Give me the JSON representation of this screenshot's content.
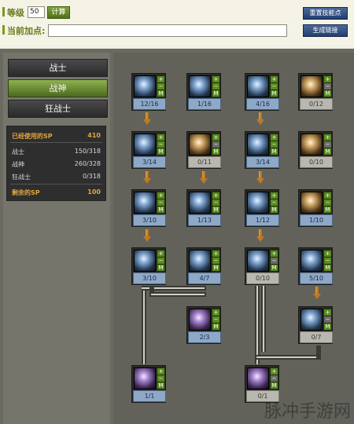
{
  "top": {
    "level_label": "等级",
    "level_value": "50",
    "calc_button": "计算",
    "points_label": "当前加点:",
    "points_value": "",
    "reset_button": "重置技能点",
    "link_button": "生成链接"
  },
  "jobs": [
    {
      "label": "战士",
      "active": false
    },
    {
      "label": "战神",
      "active": true
    },
    {
      "label": "狂战士",
      "active": false
    }
  ],
  "sp": {
    "used_label": "已经使用的SP",
    "used_value": "410",
    "rows": [
      {
        "label": "战士",
        "value": "150/318"
      },
      {
        "label": "战神",
        "value": "260/328"
      },
      {
        "label": "狂战士",
        "value": "0/318"
      }
    ],
    "remaining_label": "剩余的SP",
    "remaining_value": "100"
  },
  "skills": [
    {
      "count": "12/16",
      "icon": "skill-icon-1",
      "tone": "cool"
    },
    {
      "count": "1/16",
      "icon": "skill-icon-2",
      "tone": "cool"
    },
    {
      "count": "4/16",
      "icon": "skill-icon-3",
      "tone": "cool"
    },
    {
      "count": "0/12",
      "icon": "skill-icon-4",
      "tone": "warm"
    },
    {
      "count": "3/14",
      "icon": "skill-icon-5",
      "tone": "cool"
    },
    {
      "count": "0/11",
      "icon": "skill-icon-6",
      "tone": "warm"
    },
    {
      "count": "3/14",
      "icon": "skill-icon-7",
      "tone": "cool"
    },
    {
      "count": "0/10",
      "icon": "skill-icon-8",
      "tone": "warm"
    },
    {
      "count": "3/10",
      "icon": "skill-icon-9",
      "tone": "cool"
    },
    {
      "count": "1/13",
      "icon": "skill-icon-10",
      "tone": "cool"
    },
    {
      "count": "1/12",
      "icon": "skill-icon-11",
      "tone": "cool"
    },
    {
      "count": "1/10",
      "icon": "skill-icon-12",
      "tone": "warm"
    },
    {
      "count": "3/10",
      "icon": "skill-icon-13",
      "tone": "cool"
    },
    {
      "count": "4/7",
      "icon": "skill-icon-14",
      "tone": "cool"
    },
    {
      "count": "0/10",
      "icon": "skill-icon-15",
      "tone": "cool"
    },
    {
      "count": "5/10",
      "icon": "skill-icon-16",
      "tone": "cool"
    },
    {
      "count": "2/3",
      "icon": "skill-icon-17",
      "tone": "violet"
    },
    {
      "count": "0/7",
      "icon": "skill-icon-18",
      "tone": "cool"
    },
    {
      "count": "1/1",
      "icon": "skill-icon-19",
      "tone": "violet"
    },
    {
      "count": "0/1",
      "icon": "skill-icon-20",
      "tone": "violet"
    }
  ],
  "controls": {
    "plus": "+",
    "minus": "−",
    "max": "M"
  },
  "watermark": "脉冲手游网"
}
